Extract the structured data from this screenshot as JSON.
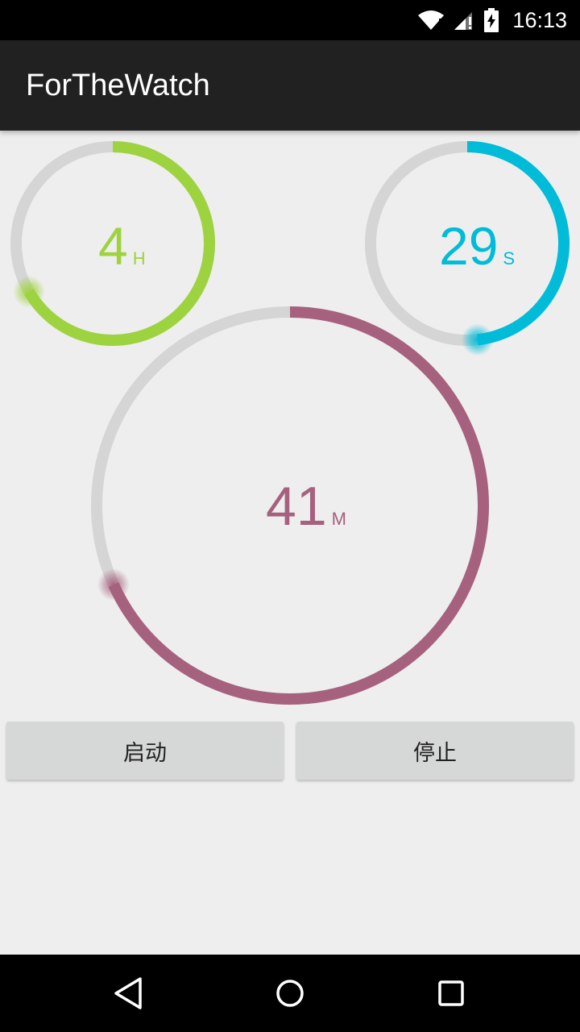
{
  "status_bar": {
    "time": "16:13",
    "icons": [
      "wifi-icon",
      "signal-icon",
      "battery-charging-icon"
    ]
  },
  "app_bar": {
    "title": "ForTheWatch"
  },
  "dials": {
    "hours": {
      "value": "4",
      "unit": "H",
      "color": "#9ed340",
      "progress": 0.667
    },
    "seconds": {
      "value": "29",
      "unit": "S",
      "color": "#00bcd8",
      "progress": 0.483
    },
    "minutes": {
      "value": "41",
      "unit": "M",
      "color": "#a6617e",
      "progress": 0.683
    },
    "track_color": "#d5d5d5"
  },
  "buttons": {
    "start_label": "启动",
    "stop_label": "停止"
  },
  "nav_bar": {
    "icons": [
      "back-icon",
      "home-icon",
      "recents-icon"
    ]
  }
}
